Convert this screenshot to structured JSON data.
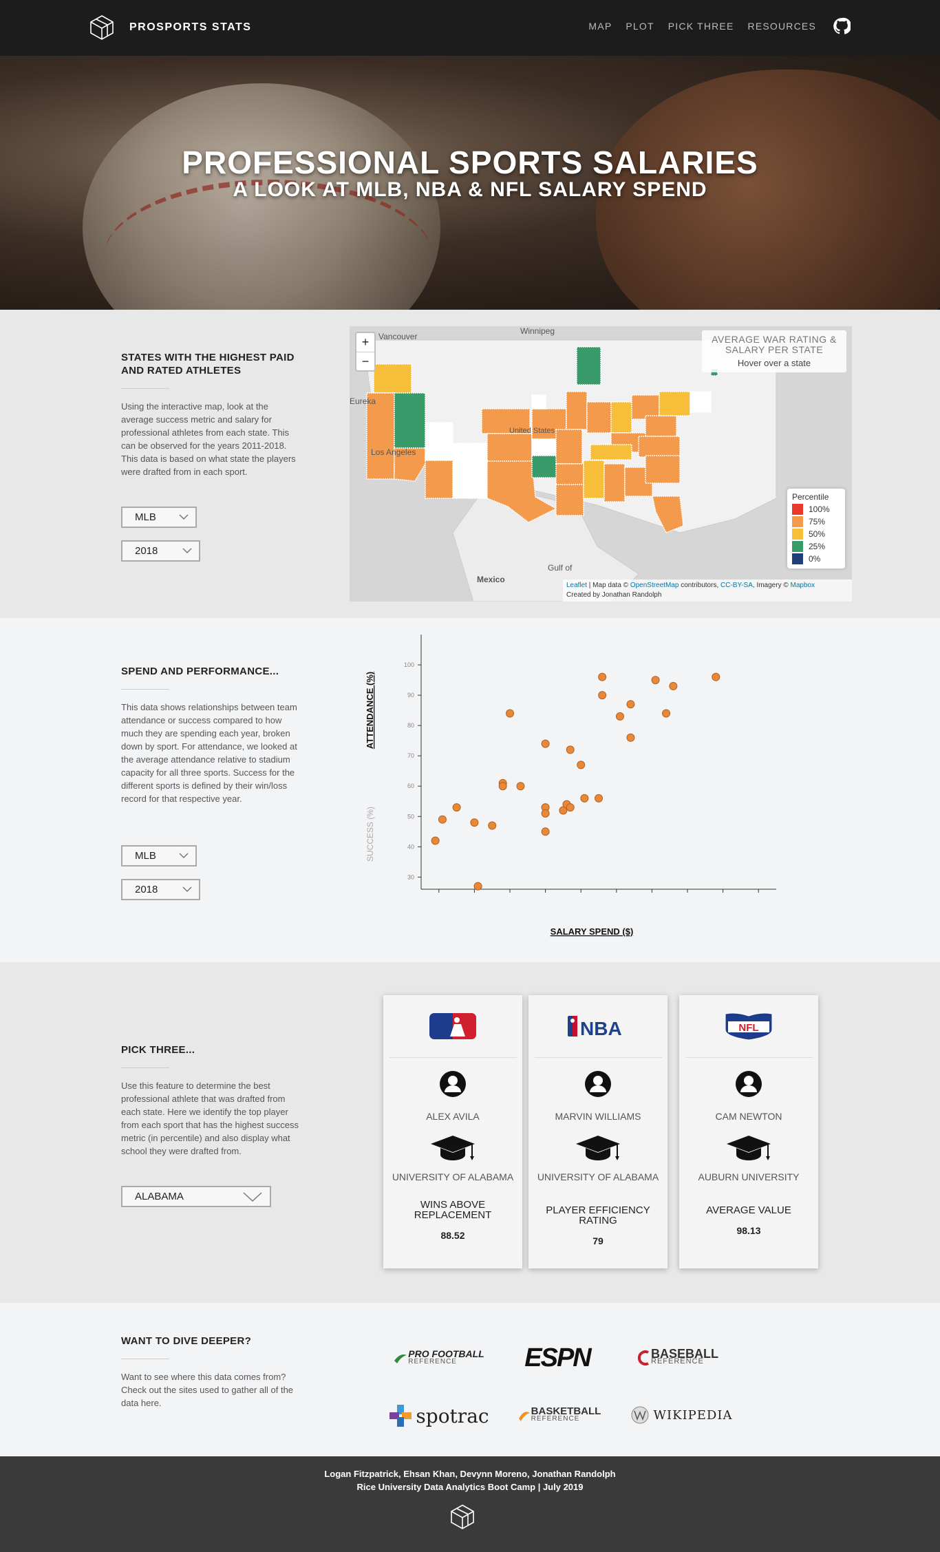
{
  "nav": {
    "brand": "PROSPORTS STATS",
    "links": [
      "MAP",
      "PLOT",
      "PICK THREE",
      "RESOURCES"
    ]
  },
  "hero": {
    "title": "PROFESSIONAL SPORTS SALARIES",
    "subtitle": "A LOOK AT MLB, NBA & NFL SALARY SPEND"
  },
  "map_section": {
    "heading": "STATES WITH THE HIGHEST PAID AND RATED ATHLETES",
    "body": "Using the interactive map, look at the average success metric and salary for professional athletes from each state. This can be observed for the years 2011-2018. This data is based on what state the players were drafted from in each sport.",
    "league_select": "MLB",
    "year_select": "2018",
    "zoom_in": "+",
    "zoom_out": "−",
    "info_title": "AVERAGE WAR RATING & SALARY PER STATE",
    "info_sub": "Hover over a state",
    "legend_title": "Percentile",
    "legend": [
      {
        "label": "100%",
        "color": "#e8392b"
      },
      {
        "label": "75%",
        "color": "#f39a4c"
      },
      {
        "label": "50%",
        "color": "#f7be3a"
      },
      {
        "label": "25%",
        "color": "#3a9b6a"
      },
      {
        "label": "0%",
        "color": "#1e3f7a"
      }
    ],
    "labels": {
      "vancouver": "Vancouver",
      "winnipeg": "Winnipeg",
      "eureka": "Eureka",
      "united_states": "United States",
      "los_angeles": "Los Angeles",
      "mexico": "Mexico",
      "gulf": "Gulf of"
    },
    "attribution_leaflet": "Leaflet",
    "attribution_text1": " | Map data © ",
    "attribution_osm": "OpenStreetMap",
    "attribution_text2": " contributors, ",
    "attribution_cc": "CC-BY-SA",
    "attribution_text3": ", Imagery © ",
    "attribution_mapbox": "Mapbox",
    "attribution_created": "Created by Jonathan Randolph"
  },
  "plot_section": {
    "heading": "SPEND AND PERFORMANCE...",
    "body": "This data shows relationships between team attendance or success compared to how much they are spending each year, broken down by sport. For attendance, we looked at the average attendance relative to stadium capacity for all three sports. Success for the different sports is defined by their win/loss record for that respective year.",
    "league_select": "MLB",
    "year_select": "2018",
    "chart_data": {
      "type": "scatter",
      "xlabel": "SALARY SPEND ($)",
      "ylabel": "ATTENDANCE (%)",
      "ylabel_alt": "SUCCESS (%)",
      "yticks": [
        100,
        90,
        80,
        70,
        60,
        50,
        40,
        30
      ],
      "xtick_count": 10,
      "ylim": [
        26,
        110
      ],
      "points": [
        [
          0.04,
          42
        ],
        [
          0.06,
          49
        ],
        [
          0.1,
          53
        ],
        [
          0.15,
          48
        ],
        [
          0.16,
          27
        ],
        [
          0.2,
          47
        ],
        [
          0.23,
          61
        ],
        [
          0.23,
          60
        ],
        [
          0.25,
          84
        ],
        [
          0.28,
          60
        ],
        [
          0.35,
          74
        ],
        [
          0.35,
          53
        ],
        [
          0.35,
          51
        ],
        [
          0.35,
          45
        ],
        [
          0.4,
          52
        ],
        [
          0.41,
          54
        ],
        [
          0.42,
          53
        ],
        [
          0.42,
          72
        ],
        [
          0.45,
          67
        ],
        [
          0.46,
          56
        ],
        [
          0.5,
          56
        ],
        [
          0.51,
          96
        ],
        [
          0.51,
          90
        ],
        [
          0.56,
          83
        ],
        [
          0.59,
          87
        ],
        [
          0.59,
          76
        ],
        [
          0.66,
          95
        ],
        [
          0.69,
          84
        ],
        [
          0.71,
          93
        ],
        [
          0.83,
          96
        ]
      ]
    }
  },
  "pick_section": {
    "heading": "PICK THREE...",
    "body": "Use this feature to determine the best professional athlete that was drafted from each state. Here we identify the top player from each sport that has the highest success metric (in percentile) and also display what school they were drafted from.",
    "state_select": "ALABAMA",
    "cards": [
      {
        "league": "MLB",
        "player": "ALEX AVILA",
        "school": "UNIVERSITY OF ALABAMA",
        "metric": "WINS ABOVE REPLACEMENT",
        "value": "88.52"
      },
      {
        "league": "NBA",
        "player": "MARVIN WILLIAMS",
        "school": "UNIVERSITY OF ALABAMA",
        "metric": "PLAYER EFFICIENCY RATING",
        "value": "79"
      },
      {
        "league": "NFL",
        "player": "CAM NEWTON",
        "school": "AUBURN UNIVERSITY",
        "metric": "AVERAGE VALUE",
        "value": "98.13"
      }
    ]
  },
  "deeper_section": {
    "heading": "WANT TO DIVE DEEPER?",
    "body": "Want to see where this data comes from? Check out the sites used to gather all of the data here.",
    "sources": [
      {
        "top": "PRO FOOTBALL",
        "bottom": "REFERENCE"
      },
      {
        "top": "ESPN",
        "bottom": ""
      },
      {
        "top": "BASEBALL",
        "bottom": "REFERENCE"
      },
      {
        "top": "spotrac",
        "bottom": ""
      },
      {
        "top": "BASKETBALL",
        "bottom": "REFERENCE"
      },
      {
        "top": "WIKIPEDIA",
        "bottom": ""
      }
    ]
  },
  "footer": {
    "authors": "Logan Fitzpatrick, Ehsan Khan, Devynn Moreno, Jonathan Randolph",
    "course": "Rice University Data Analytics Boot Camp | July 2019"
  }
}
